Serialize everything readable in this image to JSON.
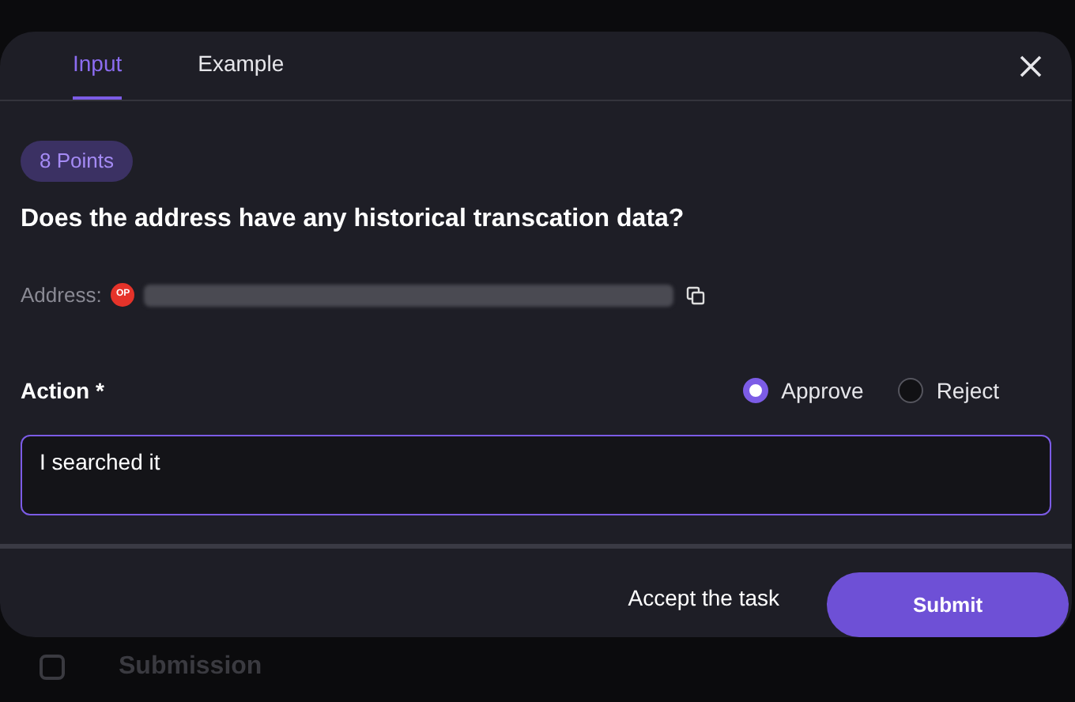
{
  "background": {
    "section": "Submission"
  },
  "dialog": {
    "tabs": [
      {
        "label": "Input",
        "selected": true
      },
      {
        "label": "Example",
        "selected": false
      }
    ],
    "points_badge": "8 Points",
    "question": "Does the address have any historical transcation data?",
    "address": {
      "label": "Address:",
      "network_badge": "OP"
    },
    "action": {
      "label": "Action *",
      "options": [
        {
          "label": "Approve",
          "selected": true
        },
        {
          "label": "Reject",
          "selected": false
        }
      ]
    },
    "answer": {
      "value": "I searched it"
    },
    "footer": {
      "secondary": "Accept the task",
      "primary": "Submit"
    }
  }
}
